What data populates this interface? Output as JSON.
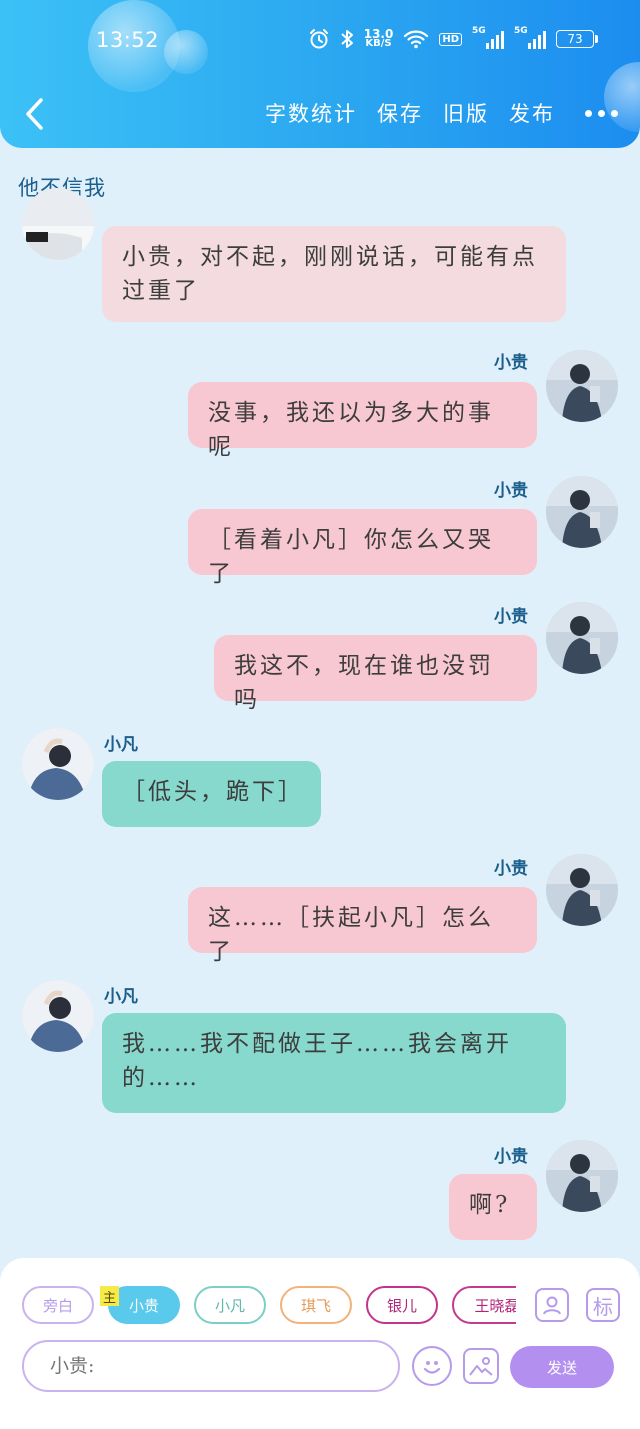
{
  "status_bar": {
    "time": "13:52",
    "net_speed_value": "13.0",
    "net_speed_unit": "KB/S",
    "hd_badge": "HD",
    "signal1_label": "5G",
    "signal2_label": "5G",
    "battery": "73"
  },
  "header": {
    "actions": [
      "字数统计",
      "保存",
      "旧版",
      "发布"
    ]
  },
  "chat": {
    "title": "他不信我",
    "messages": [
      {
        "side": "left",
        "name": "",
        "text": "小贵，对不起，刚刚说话，可能有点过重了"
      },
      {
        "side": "right",
        "name": "小贵",
        "text": "没事，我还以为多大的事呢"
      },
      {
        "side": "right",
        "name": "小贵",
        "text": "［看着小凡］你怎么又哭了"
      },
      {
        "side": "right",
        "name": "小贵",
        "text": "我这不，现在谁也没罚吗"
      },
      {
        "side": "left",
        "name": "小凡",
        "text": "［低头，跪下］"
      },
      {
        "side": "right",
        "name": "小贵",
        "text": "这……［扶起小凡］怎么了"
      },
      {
        "side": "left",
        "name": "小凡",
        "text": "我……我不配做王子……我会离开的……"
      },
      {
        "side": "right",
        "name": "小贵",
        "text": "啊?"
      }
    ]
  },
  "composer": {
    "chips": [
      "旁白",
      "小贵",
      "小凡",
      "琪飞",
      "银儿",
      "王晓磊"
    ],
    "main_tag": "主",
    "tool_label_icon": "标",
    "input_placeholder": "小贵:",
    "send_label": "发送"
  },
  "colors": {
    "header_gradient_start": "#3cc1f6",
    "header_gradient_end": "#1c8df0",
    "background": "#dff0fb",
    "bubble_pink": "#f8c8d2",
    "bubble_teal": "#87d8cd",
    "name_color": "#1d5f8c",
    "send_button": "#b38ff0"
  }
}
